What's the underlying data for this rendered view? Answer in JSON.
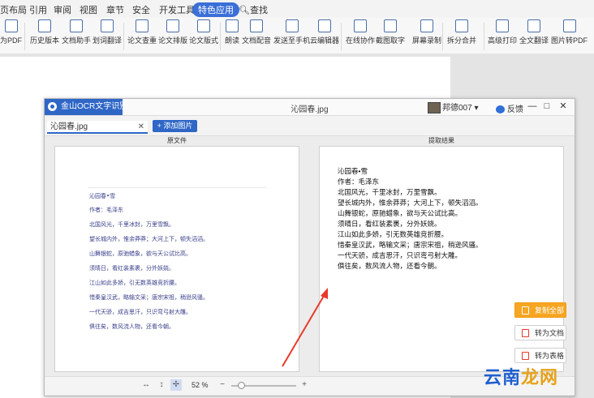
{
  "ribbon_tabs": [
    "页布局",
    "引用",
    "审阅",
    "视图",
    "章节",
    "安全",
    "开发工具",
    "特色应用",
    "查找"
  ],
  "ribbon_buttons": [
    "为PDF",
    "历史版本",
    "文档助手",
    "划词翻译",
    "论文查重",
    "论文排版",
    "论文版式",
    "朗读",
    "文档配音",
    "发送至手机",
    "云编辑器",
    "在线协作",
    "截图取字",
    "屏幕录制",
    "拆分合并",
    "高级打印",
    "全文翻译",
    "图片转PDF"
  ],
  "dialog": {
    "title": "金山OCR文字识别",
    "filename": "沁园春.jpg",
    "user_name": "邦德007",
    "feedback": "反馈",
    "file_tab": "沁园春.jpg",
    "add_image": "+ 添加图片",
    "pane_left_title": "原文件",
    "pane_right_title": "提取结果",
    "zoom": "52 %"
  },
  "source_lines": [
    "沁园春•雪",
    "作者：毛泽东",
    "北国风光，千里冰封，万里雪飘。",
    "望长城内外，惟余莽莽；大河上下，顿失滔滔。",
    "山舞银蛇，原驰蜡象，欲与天公试比高。",
    "须晴日，看红装素裹，分外妖娆。",
    "江山如此多娇，引无数英雄竞折腰。",
    "惜秦皇汉武，略输文采；唐宗宋祖，稍逊风骚。",
    "一代天骄，成吉思汗，只识弯弓射大雕。",
    "俱往矣，数风流人物，还看今朝。"
  ],
  "result_lines": [
    "沁园春•雪",
    "作者：毛泽东",
    "北国风光，千里冰封，万里雪飘。",
    "望长城内外，惟余莽莽；大河上下，顿失滔滔。",
    "山舞银蛇，原驰蜡象，欲与天公试比高。",
    "须晴日，看红装素裹，分外妖娆。",
    "江山如此多娇，引无数英雄竞折腰。",
    "惜秦皇汉武，略输文采；唐宗宋祖，稍逊风骚。",
    "一代天骄，成吉思汗，只识弯弓射大雕。",
    "俱往矣，数风流人物，还看今朝。"
  ],
  "action_buttons": [
    "复制全部",
    "转为文档",
    "转为表格"
  ],
  "watermark": {
    "part1": "云南",
    "part2": "龙网"
  },
  "colors": {
    "accent": "#2f67c7",
    "orange": "#f6a623",
    "arrow": "#e8392a"
  }
}
